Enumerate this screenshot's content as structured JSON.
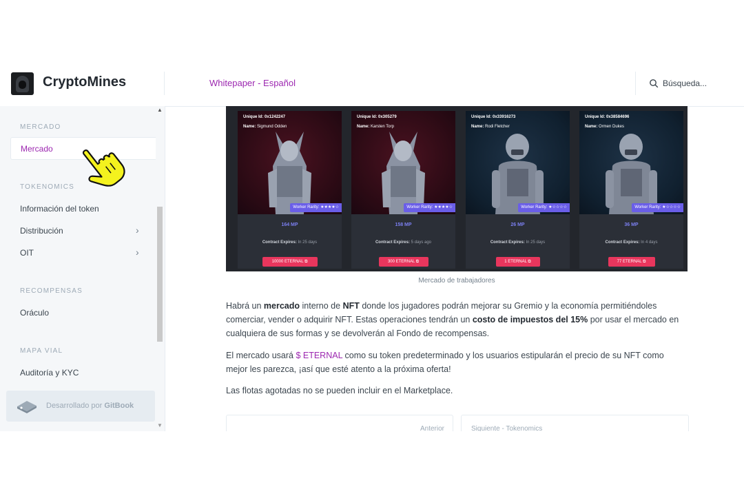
{
  "header": {
    "brand": "CryptoMines",
    "space_title": "Whitepaper - Español",
    "search_placeholder": "Búsqueda..."
  },
  "sidebar": {
    "sections": [
      {
        "title": "MERCADO",
        "items": [
          {
            "label": "Mercado",
            "active": true
          }
        ]
      },
      {
        "title": "TOKENOMICS",
        "items": [
          {
            "label": "Información del token"
          },
          {
            "label": "Distribución",
            "expandable": true
          },
          {
            "label": "OIT",
            "expandable": true
          }
        ]
      },
      {
        "title": "RECOMPENSAS",
        "items": [
          {
            "label": "Oráculo"
          }
        ]
      },
      {
        "title": "MAPA VIAL",
        "items": [
          {
            "label": "Auditoría y KYC"
          }
        ]
      }
    ],
    "footer": "Desarrollado por",
    "footer_brand": "GitBook"
  },
  "figure": {
    "caption": "Mercado de trabajadores",
    "cards": [
      {
        "id": "0x1242247",
        "name": "Sigmund Odden",
        "rarity": "★★★★☆",
        "mp": "164 MP",
        "expires": "In 25 days",
        "price": "10000 ETERNAL",
        "theme": "red"
      },
      {
        "id": "0x305279",
        "name": "Karsten Torp",
        "rarity": "★★★★☆",
        "mp": "158 MP",
        "expires": "5 days ago",
        "price": "300 ETERNAL",
        "theme": "red"
      },
      {
        "id": "0x33916273",
        "name": "Rodi Fletcher",
        "rarity": "★☆☆☆☆",
        "mp": "26 MP",
        "expires": "In 25 days",
        "price": "1 ETERNAL",
        "theme": "blue"
      },
      {
        "id": "0x38584696",
        "name": "Ormen Dukes",
        "rarity": "★☆☆☆☆",
        "mp": "36 MP",
        "expires": "In 4 days",
        "price": "77 ETERNAL",
        "theme": "blue"
      }
    ],
    "labels": {
      "unique_id": "Unique Id:",
      "name": "Name:",
      "rarity": "Worker Rarity:",
      "contract": "Contract Expires:"
    }
  },
  "content": {
    "p1": {
      "a": "Habrá un ",
      "b": "mercado",
      "c": " interno de ",
      "d": "NFT",
      "e": " donde los jugadores podrán mejorar su Gremio y la economía permitiéndoles comerciar, vender o adquirir NFT. Estas operaciones tendrán un ",
      "f": "costo de impuestos del 15%",
      "g": " por usar el mercado en cualquiera de sus formas y se devolverán al Fondo de recompensas."
    },
    "p2": {
      "a": "El mercado usará ",
      "b": "$ ETERNAL",
      "c": " como su token predeterminado y los usuarios estipularán el precio de su NFT como mejor les parezca, ¡así que esté atento a la próxima oferta!"
    },
    "p3": "Las flotas agotadas no se pueden incluir en el Marketplace."
  },
  "pagination": {
    "prev": "Anterior",
    "next": "Siguiente - Tokenomics"
  },
  "colors": {
    "accent": "#9c27b0",
    "price": "#e8365d",
    "rarity": "#6a5ee8"
  }
}
